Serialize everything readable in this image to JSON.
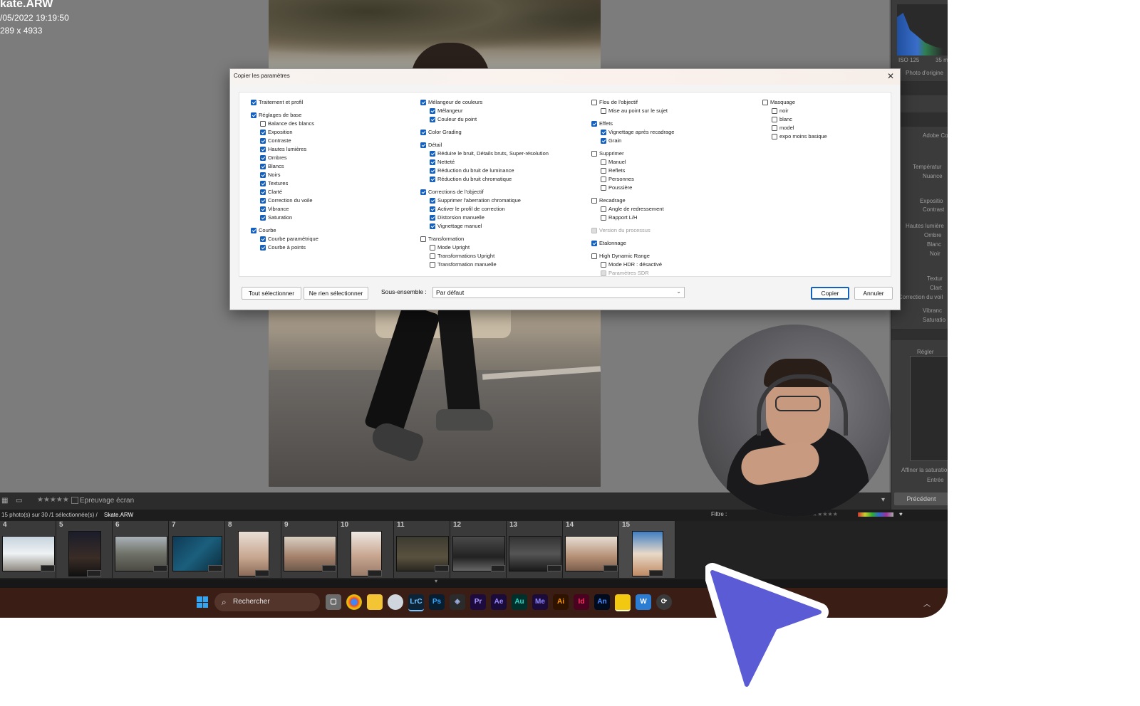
{
  "loupe_info": {
    "filename": "kate.ARW",
    "datetime": "/05/2022 19:19:50",
    "dimensions": "289 x 4933"
  },
  "toolbar": {
    "stars": "★★★★★",
    "softproof": "Epreuvage écran"
  },
  "filmstrip": {
    "status_prefix": "15 photo(s) sur 30 /1 sélectionnée(s) /",
    "current_file": "Skate.ARW",
    "filter_label": "Filtre :",
    "cells": [
      {
        "num": "4"
      },
      {
        "num": "5"
      },
      {
        "num": "6"
      },
      {
        "num": "7"
      },
      {
        "num": "8"
      },
      {
        "num": "9"
      },
      {
        "num": "10"
      },
      {
        "num": "11"
      },
      {
        "num": "12"
      },
      {
        "num": "13"
      },
      {
        "num": "14"
      },
      {
        "num": "15"
      }
    ]
  },
  "right_panel": {
    "iso": "ISO 125",
    "focal": "35 m",
    "original": "Photo d'origine",
    "profile": "Adobe Cou",
    "labels": [
      "Températur",
      "Nuance",
      "Expositio",
      "Contrast",
      "Hautes lumière",
      "Ombre",
      "Blanc",
      "Noir",
      "Textur",
      "Clart",
      "Correction du voil",
      "Vibranc",
      "Saturatio"
    ],
    "curve_tab": "Régler",
    "curve_caption": "Affiner la saturation",
    "input": "Entrée",
    "previous_button": "Précédent"
  },
  "taskbar": {
    "search_placeholder": "Rechercher",
    "apps": [
      "LrC",
      "Ps",
      "Pr",
      "Ae",
      "Au",
      "Me",
      "Ai",
      "Id",
      "An"
    ]
  },
  "dialog": {
    "title": "Copier les paramètres",
    "columns": [
      [
        {
          "label": "Traitement et profil",
          "checked": true,
          "indent": 0
        },
        {
          "label": "Réglages de base",
          "checked": true,
          "indent": 0,
          "gap": true
        },
        {
          "label": "Balance des blancs",
          "checked": false,
          "indent": 1
        },
        {
          "label": "Exposition",
          "checked": true,
          "indent": 1
        },
        {
          "label": "Contraste",
          "checked": true,
          "indent": 1
        },
        {
          "label": "Hautes lumières",
          "checked": true,
          "indent": 1
        },
        {
          "label": "Ombres",
          "checked": true,
          "indent": 1
        },
        {
          "label": "Blancs",
          "checked": true,
          "indent": 1
        },
        {
          "label": "Noirs",
          "checked": true,
          "indent": 1
        },
        {
          "label": "Textures",
          "checked": true,
          "indent": 1
        },
        {
          "label": "Clarté",
          "checked": true,
          "indent": 1
        },
        {
          "label": "Correction du voile",
          "checked": true,
          "indent": 1
        },
        {
          "label": "Vibrance",
          "checked": true,
          "indent": 1
        },
        {
          "label": "Saturation",
          "checked": true,
          "indent": 1
        },
        {
          "label": "Courbe",
          "checked": true,
          "indent": 0,
          "gap": true
        },
        {
          "label": "Courbe paramétrique",
          "checked": true,
          "indent": 1
        },
        {
          "label": "Courbe à points",
          "checked": true,
          "indent": 1
        }
      ],
      [
        {
          "label": "Mélangeur de couleurs",
          "checked": true,
          "indent": 0
        },
        {
          "label": "Mélangeur",
          "checked": true,
          "indent": 1
        },
        {
          "label": "Couleur du point",
          "checked": true,
          "indent": 1
        },
        {
          "label": "Color Grading",
          "checked": true,
          "indent": 0,
          "gap": true
        },
        {
          "label": "Détail",
          "checked": true,
          "indent": 0,
          "gap": true
        },
        {
          "label": "Réduire le bruit, Détails bruts, Super-résolution",
          "checked": true,
          "indent": 1
        },
        {
          "label": "Netteté",
          "checked": true,
          "indent": 1
        },
        {
          "label": "Réduction du bruit de luminance",
          "checked": true,
          "indent": 1
        },
        {
          "label": "Réduction du bruit chromatique",
          "checked": true,
          "indent": 1
        },
        {
          "label": "Corrections de l'objectif",
          "checked": true,
          "indent": 0,
          "gap": true
        },
        {
          "label": "Supprimer l'aberration chromatique",
          "checked": true,
          "indent": 1
        },
        {
          "label": "Activer le profil de correction",
          "checked": true,
          "indent": 1
        },
        {
          "label": "Distorsion manuelle",
          "checked": true,
          "indent": 1
        },
        {
          "label": "Vignettage manuel",
          "checked": true,
          "indent": 1
        },
        {
          "label": "Transformation",
          "checked": false,
          "indent": 0,
          "gap": true
        },
        {
          "label": "Mode Upright",
          "checked": false,
          "indent": 1
        },
        {
          "label": "Transformations Upright",
          "checked": false,
          "indent": 1
        },
        {
          "label": "Transformation manuelle",
          "checked": false,
          "indent": 1
        }
      ],
      [
        {
          "label": "Flou de l'objectif",
          "checked": false,
          "indent": 0
        },
        {
          "label": "Mise au point sur le sujet",
          "checked": false,
          "indent": 1
        },
        {
          "label": "Effets",
          "checked": true,
          "indent": 0,
          "gap": true
        },
        {
          "label": "Vignettage après recadrage",
          "checked": true,
          "indent": 1
        },
        {
          "label": "Grain",
          "checked": true,
          "indent": 1
        },
        {
          "label": "Supprimer",
          "checked": false,
          "indent": 0,
          "gap": true
        },
        {
          "label": "Manuel",
          "checked": false,
          "indent": 1
        },
        {
          "label": "Reflets",
          "checked": false,
          "indent": 1
        },
        {
          "label": "Personnes",
          "checked": false,
          "indent": 1
        },
        {
          "label": "Poussière",
          "checked": false,
          "indent": 1
        },
        {
          "label": "Recadrage",
          "checked": false,
          "indent": 0,
          "gap": true
        },
        {
          "label": "Angle de redressement",
          "checked": false,
          "indent": 1
        },
        {
          "label": "Rapport L/H",
          "checked": false,
          "indent": 1
        },
        {
          "label": "Version du processus",
          "checked": false,
          "indent": 0,
          "gap": true,
          "disabled": true
        },
        {
          "label": "Etalonnage",
          "checked": true,
          "indent": 0,
          "gap": true
        },
        {
          "label": "High Dynamic Range",
          "checked": false,
          "indent": 0,
          "gap": true
        },
        {
          "label": "Mode HDR : désactivé",
          "checked": false,
          "indent": 1
        },
        {
          "label": "Paramètres SDR",
          "checked": false,
          "indent": 1,
          "disabled": true
        }
      ],
      [
        {
          "label": "Masquage",
          "checked": false,
          "indent": 0
        },
        {
          "label": "noir",
          "checked": false,
          "indent": 1
        },
        {
          "label": "blanc",
          "checked": false,
          "indent": 1
        },
        {
          "label": "model",
          "checked": false,
          "indent": 1
        },
        {
          "label": "expo moins basique",
          "checked": false,
          "indent": 1
        }
      ]
    ],
    "select_all": "Tout sélectionner",
    "select_none": "Ne rien sélectionner",
    "subset_label": "Sous-ensemble :",
    "subset_value": "Par défaut",
    "copy": "Copier",
    "cancel": "Annuler",
    "accent_color": "#1560bd"
  },
  "cursor_color": "#5b5bd6"
}
